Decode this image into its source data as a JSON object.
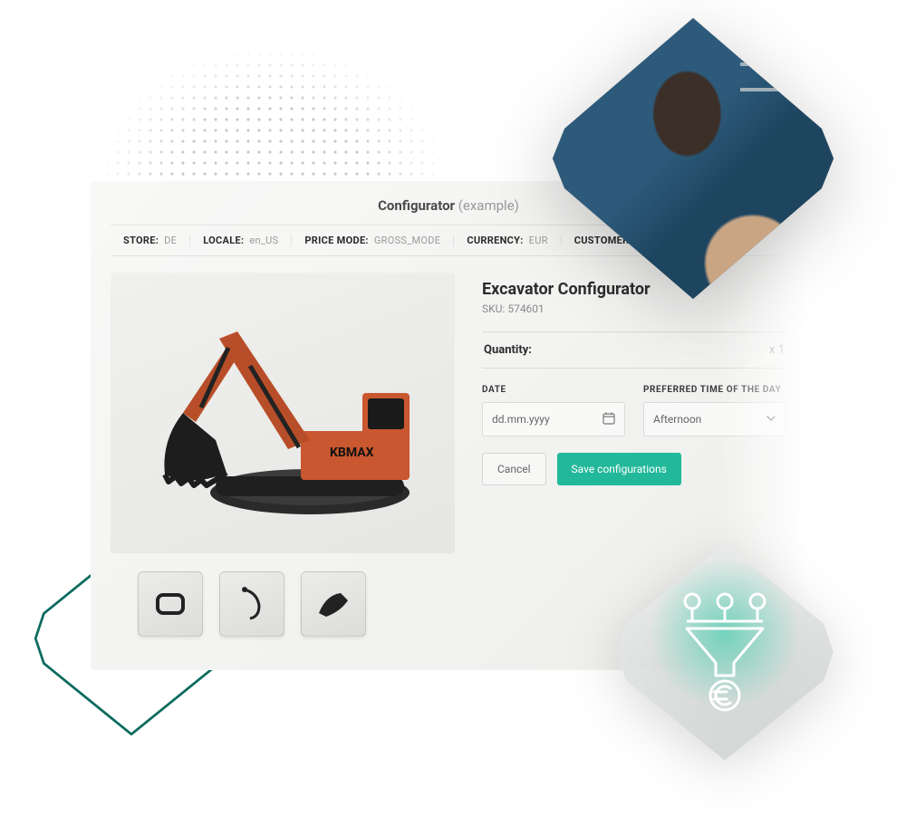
{
  "panel": {
    "title": "Configurator",
    "title_suffix": "(example)"
  },
  "meta": {
    "store_label": "STORE:",
    "store_value": "DE",
    "locale_label": "LOCALE:",
    "locale_value": "en_US",
    "price_mode_label": "PRICE MODE:",
    "price_mode_value": "GROSS_MODE",
    "currency_label": "CURRENCY:",
    "currency_value": "EUR",
    "customer_label": "CUSTOMER"
  },
  "product": {
    "title": "Excavator Configurator",
    "sku_label": "SKU:",
    "sku_value": "574601",
    "brand": "KBMAX"
  },
  "quantity": {
    "label": "Quantity:",
    "value": "x 1"
  },
  "fields": {
    "date_label": "DATE",
    "date_placeholder": "dd.mm.yyyy",
    "time_label": "PREFERRED TIME OF THE DAY",
    "time_value": "Afternoon"
  },
  "buttons": {
    "cancel": "Cancel",
    "save": "Save configurations"
  },
  "thumbs": {
    "t1": "base-part",
    "t2": "arm-part",
    "t3": "bucket-part"
  },
  "colors": {
    "accent": "#22b89a"
  }
}
